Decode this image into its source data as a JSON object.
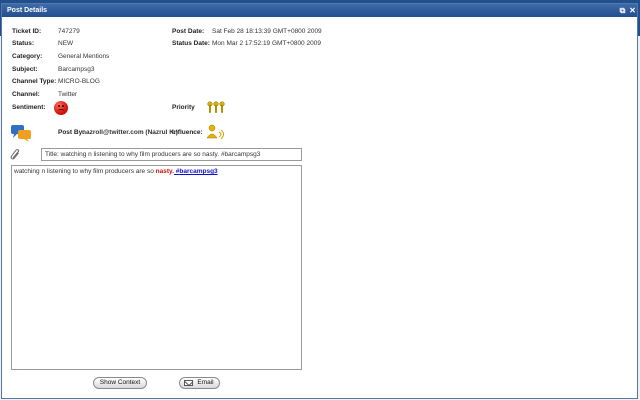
{
  "window": {
    "title": "Post Details"
  },
  "fields": {
    "ticket_id_label": "Ticket ID:",
    "ticket_id": "747279",
    "status_label": "Status:",
    "status": "NEW",
    "category_label": "Category:",
    "category": "General Mentions",
    "subject_label": "Subject:",
    "subject": "Barcampsg3",
    "channel_type_label": "Channel Type:",
    "channel_type": "MICRO-BLOG",
    "channel_label": "Channel:",
    "channel": "Twitter",
    "sentiment_label": "Sentiment:",
    "post_date_label": "Post Date:",
    "post_date": "Sat Feb 28 18:13:39 GMT+0800 2009",
    "status_date_label": "Status Date:",
    "status_date": "Mon Mar 2 17:52:19 GMT+0800 2009",
    "priority_label": "Priority",
    "post_by_label": "Post By:",
    "post_by": "nazroll@twitter.com (Nazrul K.)",
    "influence_label": "Influence:"
  },
  "post": {
    "title": "Title: watching n listening to why film producers are so nasty. #barcampsg3",
    "body_text": "watching n listening to why film producers are so ",
    "negative_word": "nasty.",
    "hashtag_prefix": " #",
    "hashtag": "barcampsg3"
  },
  "buttons": {
    "show_context": "Show Context",
    "email": "Email"
  },
  "icons": {
    "sentiment": "negative-face-icon",
    "priority": "priority-keys-icon",
    "influence": "influence-person-icon",
    "post_by": "chat-bubbles-icon",
    "attachment": "paperclip-icon",
    "email": "envelope-icon",
    "window_restore": "restore-icon",
    "window_close": "close-icon"
  },
  "colors": {
    "titlebar": "#2a5a9b",
    "negative": "#cc1111",
    "hashtag": "#1010cc"
  }
}
